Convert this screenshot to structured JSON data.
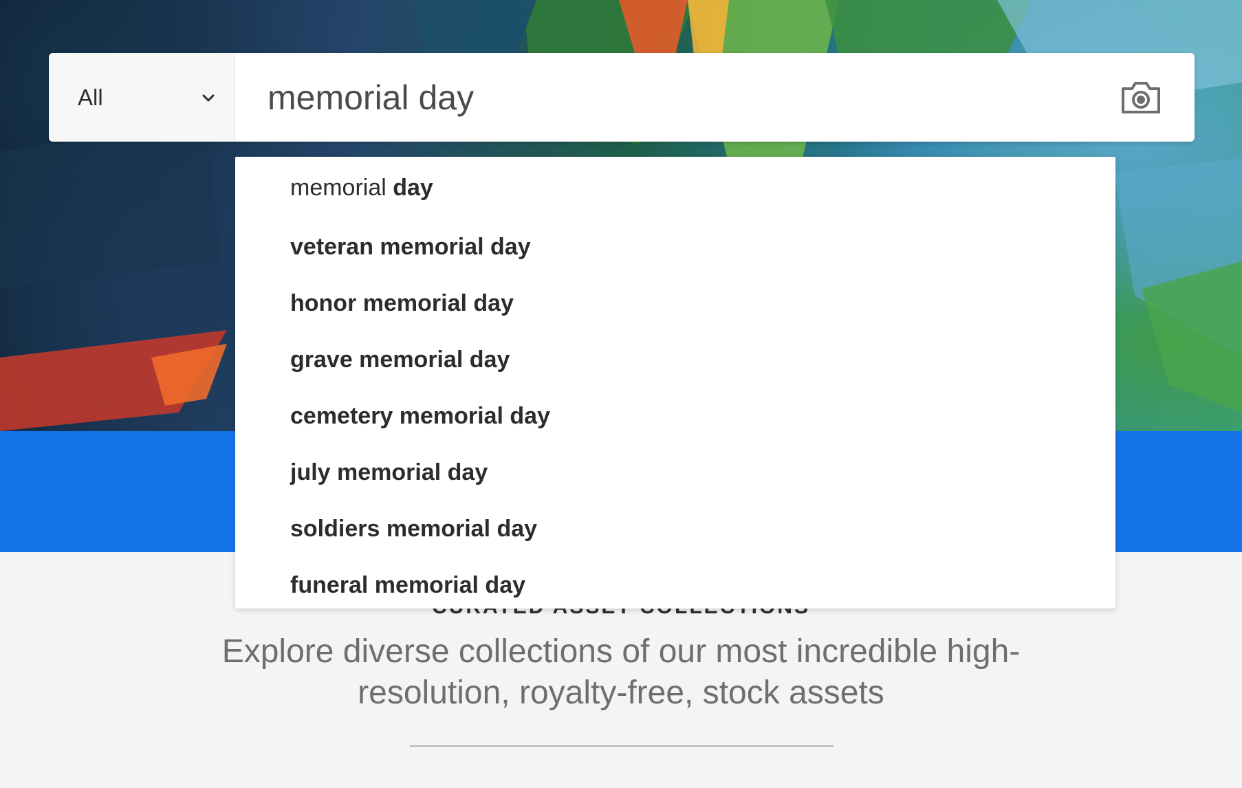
{
  "search": {
    "category": "All",
    "query": "memorial day",
    "camera_icon": "camera-icon",
    "chevron_icon": "chevron-down-icon"
  },
  "suggestions": [
    {
      "plain": "memorial ",
      "bold": "day"
    },
    {
      "plain": "",
      "bold": "veteran memorial day"
    },
    {
      "plain": "",
      "bold": "honor memorial day"
    },
    {
      "plain": "",
      "bold": "grave memorial day"
    },
    {
      "plain": "",
      "bold": "cemetery memorial day"
    },
    {
      "plain": "",
      "bold": "july memorial day"
    },
    {
      "plain": "",
      "bold": "soldiers memorial day"
    },
    {
      "plain": "",
      "bold": "funeral memorial day"
    }
  ],
  "section": {
    "eyebrow": "CURATED ASSET COLLECTIONS",
    "description": "Explore diverse collections of our most incredible high-resolution, royalty-free, stock assets"
  },
  "colors": {
    "brand_blue": "#1473e6",
    "page_background": "#f4f4f4"
  }
}
